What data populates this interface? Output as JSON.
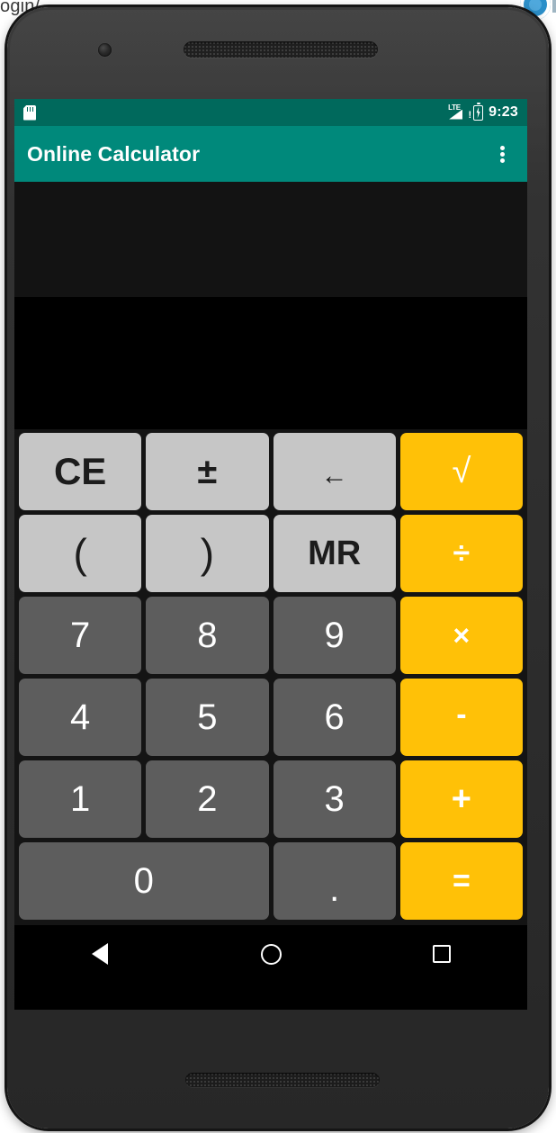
{
  "background": {
    "page_text_fragment": "ogin/",
    "avatar_icon": "account-avatar-icon"
  },
  "device": {
    "camera_icon": "front-camera-icon",
    "earpiece_icon": "earpiece-speaker-grille",
    "bottom_speaker_icon": "bottom-speaker-grille"
  },
  "status_bar": {
    "sd_card_icon": "sd-card-icon",
    "signal_label": "LTE",
    "signal_icon": "lte-signal-warning-icon",
    "battery_icon": "battery-charging-icon",
    "time": "9:23"
  },
  "app_bar": {
    "title": "Online Calculator",
    "overflow_icon": "overflow-menu-icon"
  },
  "display": {
    "expression": "",
    "result": ""
  },
  "keypad": {
    "rows": [
      [
        {
          "label": "CE",
          "name": "key-clear-entry",
          "style": "light"
        },
        {
          "label": "±",
          "name": "key-plus-minus",
          "style": "light k-pm"
        },
        {
          "label": "←",
          "name": "key-backspace",
          "style": "light k-arrow"
        },
        {
          "label": "√",
          "name": "key-square-root",
          "style": "accent k-sqrt"
        }
      ],
      [
        {
          "label": "(",
          "name": "key-open-paren",
          "style": "light k-paren"
        },
        {
          "label": ")",
          "name": "key-close-paren",
          "style": "light k-paren"
        },
        {
          "label": "MR",
          "name": "key-memory-recall",
          "style": "light k-mr"
        },
        {
          "label": "÷",
          "name": "key-divide",
          "style": "accent k-div"
        }
      ],
      [
        {
          "label": "7",
          "name": "key-7",
          "style": "dark"
        },
        {
          "label": "8",
          "name": "key-8",
          "style": "dark"
        },
        {
          "label": "9",
          "name": "key-9",
          "style": "dark"
        },
        {
          "label": "×",
          "name": "key-multiply",
          "style": "accent k-mul"
        }
      ],
      [
        {
          "label": "4",
          "name": "key-4",
          "style": "dark"
        },
        {
          "label": "5",
          "name": "key-5",
          "style": "dark"
        },
        {
          "label": "6",
          "name": "key-6",
          "style": "dark"
        },
        {
          "label": "-",
          "name": "key-subtract",
          "style": "accent k-minus"
        }
      ],
      [
        {
          "label": "1",
          "name": "key-1",
          "style": "dark"
        },
        {
          "label": "2",
          "name": "key-2",
          "style": "dark"
        },
        {
          "label": "3",
          "name": "key-3",
          "style": "dark"
        },
        {
          "label": "+",
          "name": "key-add",
          "style": "accent k-plus"
        }
      ],
      [
        {
          "label": "0",
          "name": "key-0",
          "style": "dark span2"
        },
        {
          "label": ".",
          "name": "key-decimal-point",
          "style": "dark k-dot"
        },
        {
          "label": "=",
          "name": "key-equals",
          "style": "accent k-eq"
        }
      ]
    ]
  },
  "nav_bar": {
    "back_icon": "nav-back-icon",
    "home_icon": "nav-home-icon",
    "recents_icon": "nav-recents-icon"
  },
  "colors": {
    "status_bar": "#00695c",
    "app_bar": "#00897b",
    "accent_key": "#ffc107",
    "light_key": "#c6c6c6",
    "dark_key": "#5d5d5d",
    "display_upper": "#131313",
    "display_lower": "#000000"
  }
}
